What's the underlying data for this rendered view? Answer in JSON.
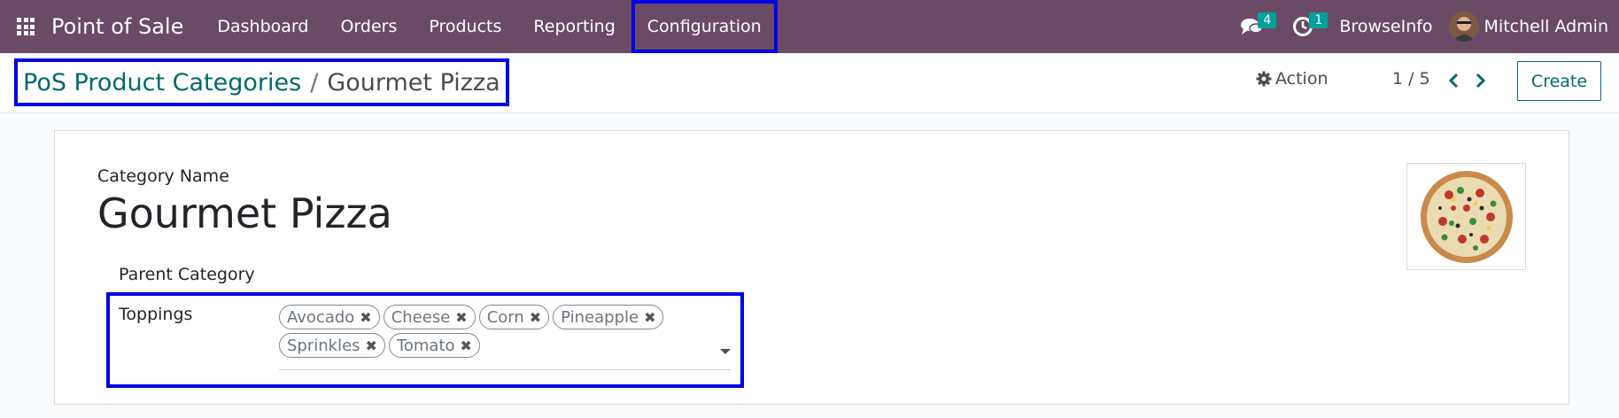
{
  "navbar": {
    "app_name": "Point of Sale",
    "menu": [
      "Dashboard",
      "Orders",
      "Products",
      "Reporting",
      "Configuration"
    ],
    "messages_count": "4",
    "activities_count": "1",
    "company": "BrowseInfo",
    "user": "Mitchell Admin"
  },
  "control": {
    "breadcrumb_parent": "PoS Product Categories",
    "breadcrumb_sep": "/",
    "breadcrumb_current": "Gourmet Pizza",
    "action_label": "Action",
    "pager": "1 / 5",
    "create_label": "Create"
  },
  "form": {
    "category_name_label": "Category Name",
    "category_name": "Gourmet Pizza",
    "parent_label": "Parent Category",
    "toppings_label": "Toppings",
    "toppings": [
      "Avocado",
      "Cheese",
      "Corn",
      "Pineapple",
      "Sprinkles",
      "Tomato"
    ]
  },
  "colors": {
    "navbar": "#6b4a66",
    "brand_teal": "#01696d",
    "highlight": "#0000e6"
  }
}
